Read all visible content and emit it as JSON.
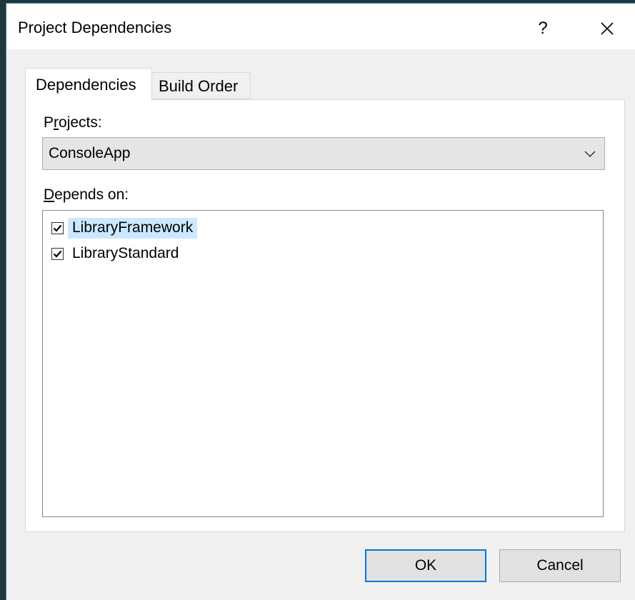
{
  "window": {
    "title": "Project Dependencies",
    "help_label": "?"
  },
  "tabs": [
    {
      "label": "Dependencies",
      "selected": true
    },
    {
      "label": "Build Order",
      "selected": false
    }
  ],
  "projects": {
    "label_mnemonic": "r",
    "label_prefix": "P",
    "label_suffix": "ojects:",
    "selected_value": "ConsoleApp"
  },
  "depends_on": {
    "label_mnemonic": "D",
    "label_suffix": "epends on:",
    "items": [
      {
        "label": "LibraryFramework",
        "checked": true,
        "selected": true
      },
      {
        "label": "LibraryStandard",
        "checked": true,
        "selected": false
      }
    ]
  },
  "buttons": {
    "ok_label": "OK",
    "cancel_label": "Cancel"
  },
  "colors": {
    "accent": "#0078d7",
    "selection": "#cce8ff"
  }
}
